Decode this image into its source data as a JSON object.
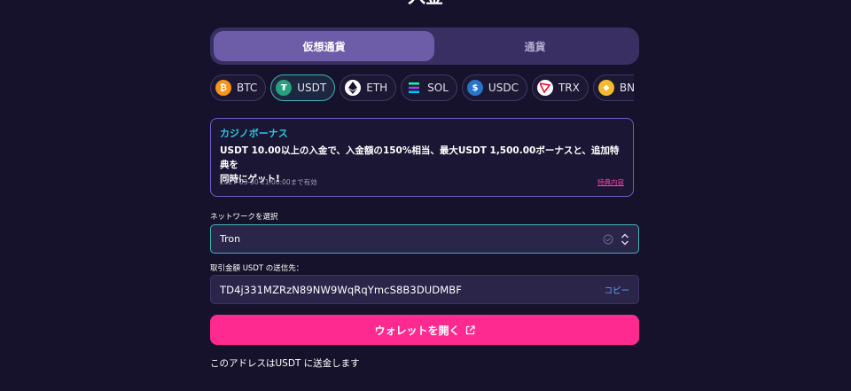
{
  "page": {
    "title": "入金"
  },
  "tabs": [
    {
      "label": "仮想通貨",
      "active": true
    },
    {
      "label": "通貨",
      "active": false
    }
  ],
  "coins": [
    {
      "label": "BTC",
      "icon": "bitcoin-icon",
      "color": "#f7931a",
      "active": false
    },
    {
      "label": "USDT",
      "icon": "tether-icon",
      "color": "#26a17b",
      "active": true
    },
    {
      "label": "ETH",
      "icon": "ethereum-icon",
      "color": "#ffffff",
      "active": false
    },
    {
      "label": "SOL",
      "icon": "solana-icon",
      "color": "#9945ff",
      "active": false
    },
    {
      "label": "USDC",
      "icon": "usdc-icon",
      "color": "#2775ca",
      "active": false
    },
    {
      "label": "TRX",
      "icon": "tron-icon",
      "color": "#ef0027",
      "active": false
    },
    {
      "label": "BNB",
      "icon": "bnb-icon",
      "color": "#f3ba2f",
      "active": false
    }
  ],
  "bonus": {
    "title": "カジノボーナス",
    "text_1": "USDT 10.00",
    "text_2": "以上の入金で、入金額の",
    "text_3": "150%",
    "text_4": "相当、最大",
    "text_5": "USDT 1,500.00",
    "text_6": "ボーナスと、追加特典を",
    "text_7": "同時にゲット!",
    "expiry": "2027-03-30 21:00:00まで有効",
    "link": "特典内容"
  },
  "network": {
    "label": "ネットワークを選択",
    "value": "Tron"
  },
  "address": {
    "label": "取引金額 USDT の送信先：",
    "value": "TD4j331MZRzN89NW9WqRqYmcS8B3DUDMBF",
    "copy_label": "コピー"
  },
  "wallet_button": {
    "label": "ウォレットを開く"
  },
  "footer_note": "このアドレスはUSDT に送金します",
  "colors": {
    "background": "#17122b",
    "accent_pink": "#ff2a8f",
    "accent_teal": "#3fb3b3",
    "bonus_title": "#27c8e6"
  }
}
